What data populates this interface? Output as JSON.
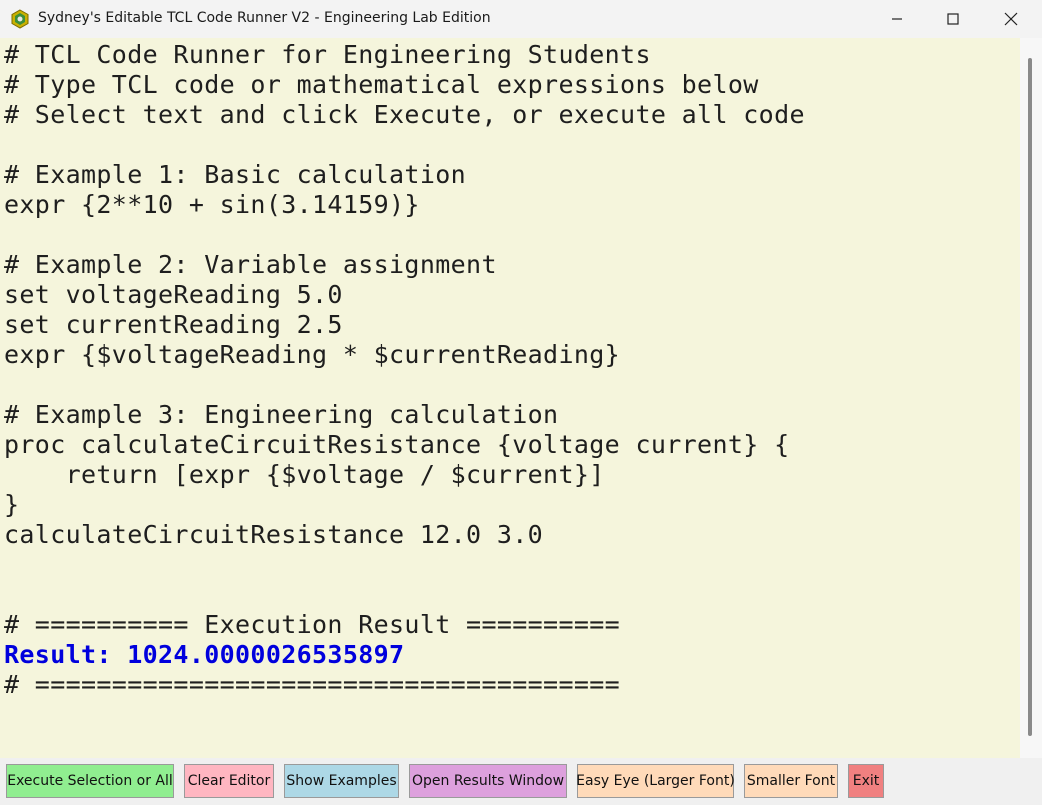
{
  "window": {
    "title": "Sydney's Editable TCL Code Runner V2 - Engineering Lab Edition"
  },
  "editor": {
    "lines": [
      {
        "text": "# TCL Code Runner for Engineering Students",
        "kind": "normal"
      },
      {
        "text": "# Type TCL code or mathematical expressions below",
        "kind": "normal"
      },
      {
        "text": "# Select text and click Execute, or execute all code",
        "kind": "normal"
      },
      {
        "text": "",
        "kind": "normal"
      },
      {
        "text": "# Example 1: Basic calculation",
        "kind": "normal"
      },
      {
        "text": "expr {2**10 + sin(3.14159)}",
        "kind": "normal"
      },
      {
        "text": "",
        "kind": "normal"
      },
      {
        "text": "# Example 2: Variable assignment",
        "kind": "normal"
      },
      {
        "text": "set voltageReading 5.0",
        "kind": "normal"
      },
      {
        "text": "set currentReading 2.5",
        "kind": "normal"
      },
      {
        "text": "expr {$voltageReading * $currentReading}",
        "kind": "normal"
      },
      {
        "text": "",
        "kind": "normal"
      },
      {
        "text": "# Example 3: Engineering calculation",
        "kind": "normal"
      },
      {
        "text": "proc calculateCircuitResistance {voltage current} {",
        "kind": "normal"
      },
      {
        "text": "    return [expr {$voltage / $current}]",
        "kind": "normal"
      },
      {
        "text": "}",
        "kind": "normal"
      },
      {
        "text": "calculateCircuitResistance 12.0 3.0",
        "kind": "normal"
      },
      {
        "text": "",
        "kind": "normal"
      },
      {
        "text": "",
        "kind": "normal"
      },
      {
        "text": "# ========== Execution Result ==========",
        "kind": "normal"
      },
      {
        "text": "Result: 1024.0000026535897",
        "kind": "result"
      },
      {
        "text": "# ======================================",
        "kind": "normal"
      }
    ]
  },
  "toolbar": {
    "buttons": [
      {
        "id": "execute",
        "label": "Execute Selection or All",
        "color": "#90ee90"
      },
      {
        "id": "clear",
        "label": "Clear Editor",
        "color": "#ffb6c1"
      },
      {
        "id": "examples",
        "label": "Show Examples",
        "color": "#add8e6"
      },
      {
        "id": "results",
        "label": "Open Results Window",
        "color": "#dda0dd"
      },
      {
        "id": "larger-font",
        "label": "Easy Eye (Larger Font)",
        "color": "#ffdab9"
      },
      {
        "id": "smaller-font",
        "label": "Smaller Font",
        "color": "#ffdab9"
      },
      {
        "id": "exit",
        "label": "Exit",
        "color": "#f08080"
      }
    ]
  },
  "icons": {
    "app": "tcl-feather-icon",
    "minimize": "minimize-icon",
    "maximize": "maximize-icon",
    "close": "close-icon"
  }
}
